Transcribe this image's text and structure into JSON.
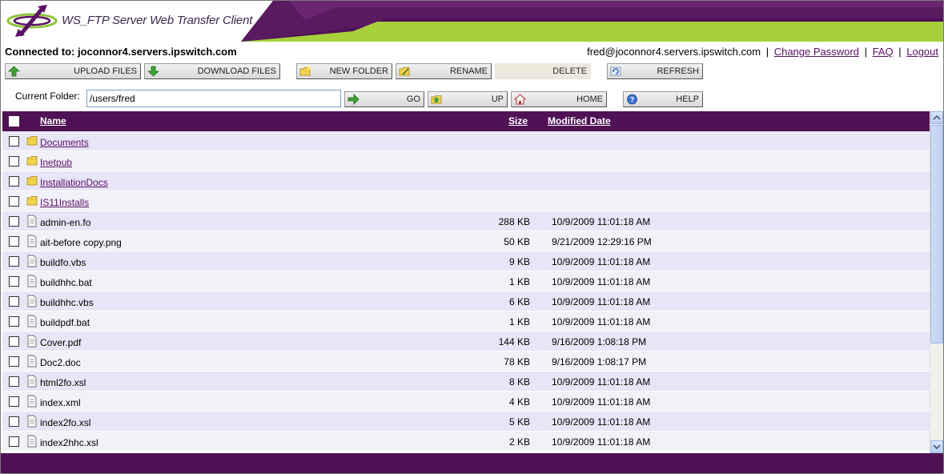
{
  "header": {
    "title": "WS_FTP Server Web Transfer Client",
    "colors": {
      "purple": "#4f1254",
      "green": "#a6cf3a"
    }
  },
  "status": {
    "connected": "Connected to: joconnor4.servers.ipswitch.com",
    "user": "fred@joconnor4.servers.ipswitch.com",
    "links": {
      "change_password": "Change Password",
      "faq": "FAQ",
      "logout": "Logout"
    },
    "separator": "|"
  },
  "toolbar": {
    "upload": "UPLOAD FILES",
    "download": "DOWNLOAD FILES",
    "new_folder": "NEW FOLDER",
    "rename": "RENAME",
    "delete": "DELETE",
    "refresh": "REFRESH"
  },
  "nav": {
    "current_folder_label": "Current Folder:",
    "current_folder_value": "/users/fred",
    "go": "GO",
    "up": "UP",
    "home": "HOME",
    "help": "HELP"
  },
  "table": {
    "columns": {
      "name": "Name",
      "size": "Size",
      "modified": "Modified Date"
    },
    "rows": [
      {
        "type": "folder",
        "name": "Documents",
        "size": "",
        "date": ""
      },
      {
        "type": "folder",
        "name": "Inetpub",
        "size": "",
        "date": ""
      },
      {
        "type": "folder",
        "name": "InstallationDocs",
        "size": "",
        "date": ""
      },
      {
        "type": "folder",
        "name": "IS11Installs",
        "size": "",
        "date": ""
      },
      {
        "type": "file",
        "name": "admin-en.fo",
        "size": "288 KB",
        "date": "10/9/2009 11:01:18 AM"
      },
      {
        "type": "file",
        "name": "ait-before copy.png",
        "size": "50 KB",
        "date": "9/21/2009 12:29:16 PM"
      },
      {
        "type": "file",
        "name": "buildfo.vbs",
        "size": "9 KB",
        "date": "10/9/2009 11:01:18 AM"
      },
      {
        "type": "file",
        "name": "buildhhc.bat",
        "size": "1 KB",
        "date": "10/9/2009 11:01:18 AM"
      },
      {
        "type": "file",
        "name": "buildhhc.vbs",
        "size": "6 KB",
        "date": "10/9/2009 11:01:18 AM"
      },
      {
        "type": "file",
        "name": "buildpdf.bat",
        "size": "1 KB",
        "date": "10/9/2009 11:01:18 AM"
      },
      {
        "type": "file",
        "name": "Cover.pdf",
        "size": "144 KB",
        "date": "9/16/2009 1:08:18 PM"
      },
      {
        "type": "file",
        "name": "Doc2.doc",
        "size": "78 KB",
        "date": "9/16/2009 1:08:17 PM"
      },
      {
        "type": "file",
        "name": "html2fo.xsl",
        "size": "8 KB",
        "date": "10/9/2009 11:01:18 AM"
      },
      {
        "type": "file",
        "name": "index.xml",
        "size": "4 KB",
        "date": "10/9/2009 11:01:18 AM"
      },
      {
        "type": "file",
        "name": "index2fo.xsl",
        "size": "5 KB",
        "date": "10/9/2009 11:01:18 AM"
      },
      {
        "type": "file",
        "name": "index2hhc.xsl",
        "size": "2 KB",
        "date": "10/9/2009 11:01:18 AM"
      }
    ]
  }
}
